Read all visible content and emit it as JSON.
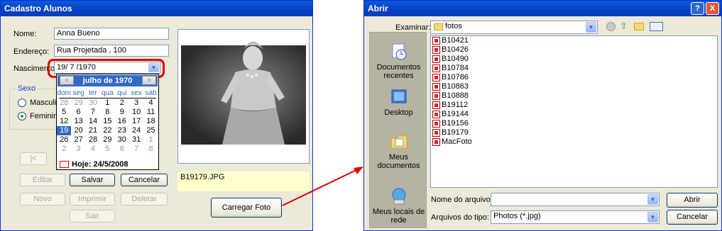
{
  "cadastro": {
    "title": "Cadastro Alunos",
    "nome_label": "Nome:",
    "nome_value": "Anna Bueno",
    "endereco_label": "Endereço:",
    "endereco_value": "Rua Projetada , 100",
    "nascimento_label": "Nascimento",
    "nascimento_value": "19/ 7 /1970",
    "sexo_label": "Sexo",
    "sexo_options": [
      "Masculin",
      "Feminino"
    ],
    "sexo_selected": "Feminino",
    "nav_first": "|<",
    "buttons": {
      "editar": "Editar",
      "salvar": "Salvar",
      "cancelar": "Cancelar",
      "novo": "Novo",
      "imprimir": "Imprimir",
      "deletar": "Deletar",
      "sair": "Sair",
      "carregar_foto": "Carregar Foto"
    },
    "foto_filename": "B19179.JPG"
  },
  "calendar": {
    "month_label": "julho de 1970",
    "prev": "<",
    "next": ">",
    "weekdays": [
      "dom",
      "seg",
      "ter",
      "qua",
      "qui",
      "sex",
      "sáb"
    ],
    "weeks": [
      [
        "28",
        "29",
        "30",
        "1",
        "2",
        "3",
        "4"
      ],
      [
        "5",
        "6",
        "7",
        "8",
        "9",
        "10",
        "11"
      ],
      [
        "12",
        "13",
        "14",
        "15",
        "16",
        "17",
        "18"
      ],
      [
        "19",
        "20",
        "21",
        "22",
        "23",
        "24",
        "25"
      ],
      [
        "26",
        "27",
        "28",
        "29",
        "30",
        "31",
        "1"
      ],
      [
        "2",
        "3",
        "4",
        "5",
        "6",
        "7",
        "8"
      ]
    ],
    "selected_day": "19",
    "today_label": "Hoje: 24/5/2008"
  },
  "abrir": {
    "title": "Abrir",
    "help": "?",
    "close": "X",
    "examinar_label": "Examinar:",
    "folder": "fotos",
    "places": [
      {
        "label": "Documentos recentes",
        "icon": "recent-documents-icon"
      },
      {
        "label": "Desktop",
        "icon": "desktop-icon"
      },
      {
        "label": "Meus documentos",
        "icon": "my-documents-icon"
      },
      {
        "label": "Meus locais de rede",
        "icon": "network-places-icon"
      }
    ],
    "files": [
      "B10421",
      "B10426",
      "B10490",
      "B10784",
      "B10786",
      "B10863",
      "B10888",
      "B19112",
      "B19144",
      "B19156",
      "B19179",
      "MacFoto"
    ],
    "nome_arquivo_label": "Nome do arquivo:",
    "nome_arquivo_value": "",
    "tipo_label": "Arquivos do tipo:",
    "tipo_value": "Photos (*.jpg)",
    "abrir_button": "Abrir",
    "cancelar_button": "Cancelar"
  },
  "colors": {
    "title_blue": "#0a4ad0",
    "highlight_red": "#e00000",
    "selected_blue": "#316ac5"
  }
}
